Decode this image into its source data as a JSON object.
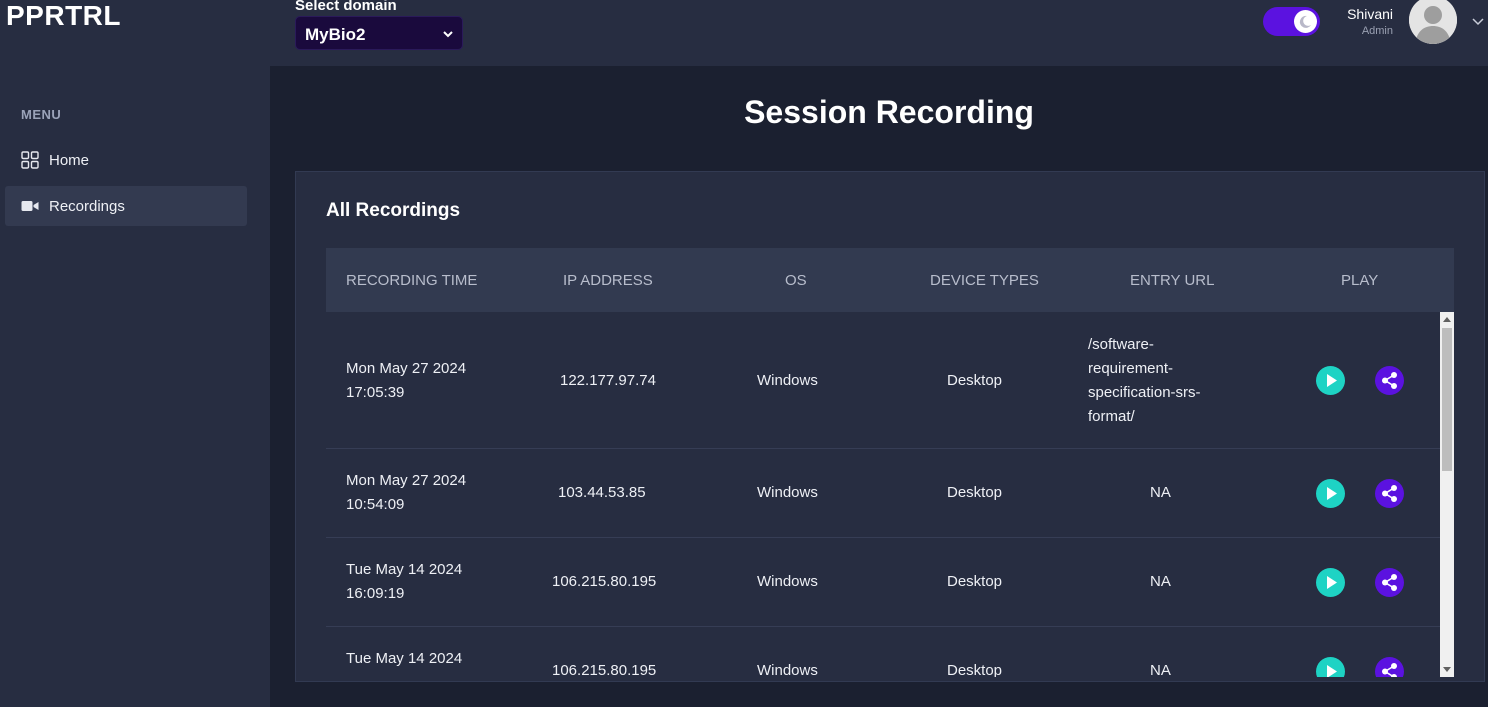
{
  "app": {
    "brand": "PPRTRL"
  },
  "header": {
    "domain_label": "Select domain",
    "domain_value": "MyBio2",
    "user_name": "Shivani",
    "user_role": "Admin"
  },
  "sidebar": {
    "menu_label": "MENU",
    "items": [
      {
        "label": "Home",
        "icon": "grid-icon",
        "active": false
      },
      {
        "label": "Recordings",
        "icon": "video-camera-icon",
        "active": true
      }
    ]
  },
  "main": {
    "title": "Session Recording",
    "card_title": "All Recordings",
    "columns": [
      "RECORDING TIME",
      "IP ADDRESS",
      "OS",
      "DEVICE TYPES",
      "ENTRY URL",
      "PLAY"
    ],
    "rows": [
      {
        "time": "Mon May 27 2024 17:05:39",
        "ip": "122.177.97.74",
        "os": "Windows",
        "device": "Desktop",
        "url": "/software-requirement-specification-srs-format/"
      },
      {
        "time": "Mon May 27 2024 10:54:09",
        "ip": "103.44.53.85",
        "os": "Windows",
        "device": "Desktop",
        "url": "NA"
      },
      {
        "time": "Tue May 14 2024 16:09:19",
        "ip": "106.215.80.195",
        "os": "Windows",
        "device": "Desktop",
        "url": "NA"
      },
      {
        "time": "Tue May 14 2024",
        "ip": "106.215.80.195",
        "os": "Windows",
        "device": "Desktop",
        "url": "NA"
      }
    ]
  },
  "colors": {
    "accent_purple": "#5b12e0",
    "play_teal": "#1ed3c4",
    "background": "#1b2030",
    "panel": "#272d41"
  }
}
